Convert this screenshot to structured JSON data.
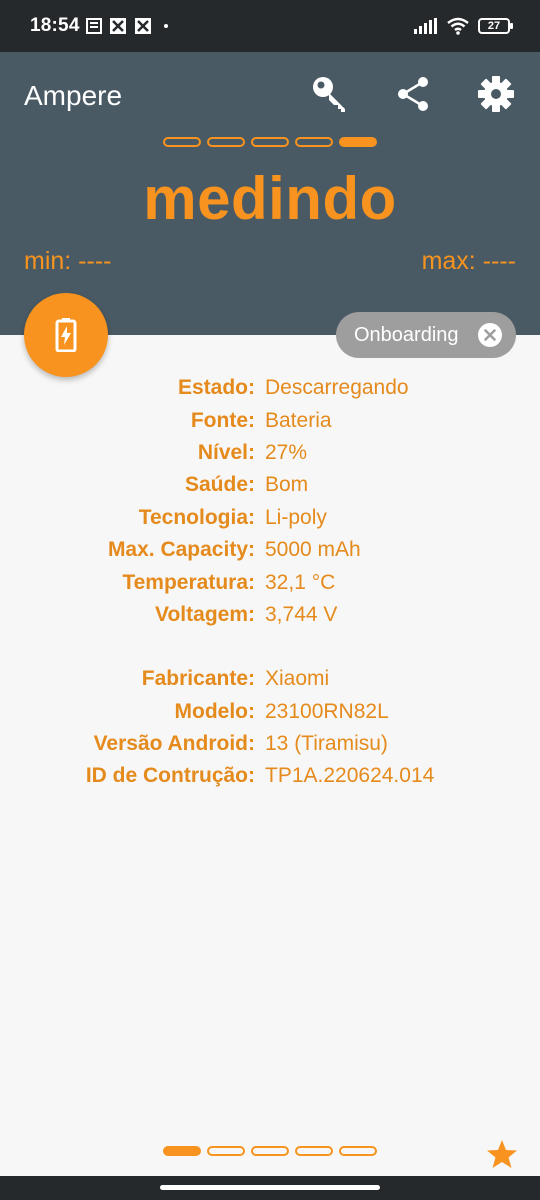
{
  "status_bar": {
    "time": "18:54",
    "battery_level": "27"
  },
  "app_bar": {
    "title": "Ampere",
    "actions": [
      "key-icon",
      "share-icon",
      "settings-icon"
    ]
  },
  "pager_top": {
    "pages": 5,
    "active_index": 4
  },
  "measurement": {
    "status": "medindo",
    "min": "min: ----",
    "max": "max: ----"
  },
  "onboarding_chip": {
    "label": "Onboarding"
  },
  "battery_info": [
    {
      "label": "Estado:",
      "value": "Descarregando"
    },
    {
      "label": "Fonte:",
      "value": "Bateria"
    },
    {
      "label": "Nível:",
      "value": "27%"
    },
    {
      "label": "Saúde:",
      "value": "Bom"
    },
    {
      "label": "Tecnologia:",
      "value": "Li-poly"
    },
    {
      "label": "Max. Capacity:",
      "value": "5000 mAh"
    },
    {
      "label": "Temperatura:",
      "value": "32,1 °C"
    },
    {
      "label": "Voltagem:",
      "value": "3,744 V"
    }
  ],
  "device_info": [
    {
      "label": "Fabricante:",
      "value": "Xiaomi"
    },
    {
      "label": "Modelo:",
      "value": "23100RN82L"
    },
    {
      "label": "Versão Android:",
      "value": "13 (Tiramisu)"
    },
    {
      "label": "ID de Contrução:",
      "value": "TP1A.220624.014"
    }
  ],
  "pager_bottom": {
    "pages": 5,
    "active_index": 0
  },
  "colors": {
    "accent": "#f7931e",
    "header_bg": "#4a5a64",
    "chip_bg": "#9e9e9e"
  }
}
